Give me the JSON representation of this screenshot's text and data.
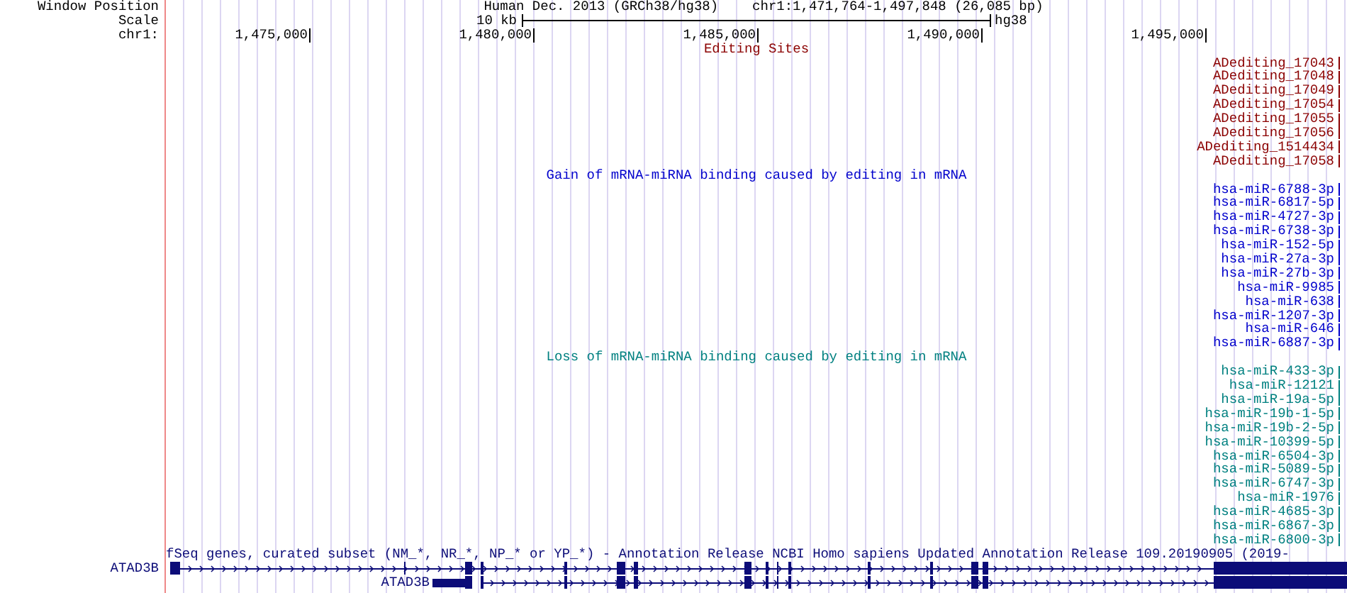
{
  "ruler": {
    "row_labels": [
      "Window Position",
      "Scale",
      "chr1:"
    ],
    "assembly_title": "Human Dec. 2013 (GRCh38/hg38)",
    "position": "chr1:1,471,764-1,497,848 (26,085 bp)",
    "scale_label": "10 kb",
    "scale_assembly": "hg38",
    "ticks": [
      "1,475,000",
      "1,480,000",
      "1,485,000",
      "1,490,000",
      "1,495,000"
    ]
  },
  "tracks": [
    {
      "kind": "features",
      "title": "Editing Sites",
      "color": "#8b0000",
      "items": [
        "ADediting_17043",
        "ADediting_17048",
        "ADediting_17049",
        "ADediting_17054",
        "ADediting_17055",
        "ADediting_17056",
        "ADediting_1514434",
        "ADediting_17058"
      ]
    },
    {
      "kind": "features",
      "title": "Gain of mRNA-miRNA binding caused by editing in mRNA",
      "color": "#0000cc",
      "items": [
        "hsa-miR-6788-3p",
        "hsa-miR-6817-5p",
        "hsa-miR-4727-3p",
        "hsa-miR-6738-3p",
        "hsa-miR-152-5p",
        "hsa-miR-27a-3p",
        "hsa-miR-27b-3p",
        "hsa-miR-9985",
        "hsa-miR-638",
        "hsa-miR-1207-3p",
        "hsa-miR-646",
        "hsa-miR-6887-3p"
      ]
    },
    {
      "kind": "features",
      "title": "Loss of mRNA-miRNA binding caused by editing in mRNA",
      "color": "#008080",
      "items": [
        "hsa-miR-433-3p",
        "hsa-miR-12121",
        "hsa-miR-19a-5p",
        "hsa-miR-19b-1-5p",
        "hsa-miR-19b-2-5p",
        "hsa-miR-10399-5p",
        "hsa-miR-6504-3p",
        "hsa-miR-5089-5p",
        "hsa-miR-6747-3p",
        "hsa-miR-1976",
        "hsa-miR-4685-3p",
        "hsa-miR-6867-3p",
        "hsa-miR-6800-3p"
      ]
    },
    {
      "kind": "genes",
      "title": "fSeq genes, curated subset (NM_*, NR_*, NP_* or YP_*) - Annotation Release NCBI Homo sapiens Updated Annotation Release 109.20190905 (2019-",
      "color": "#0c0c78",
      "genes": [
        {
          "name": "ATAD3B",
          "label_inline": false
        },
        {
          "name": "ATAD3B",
          "label_inline": true
        }
      ]
    }
  ]
}
